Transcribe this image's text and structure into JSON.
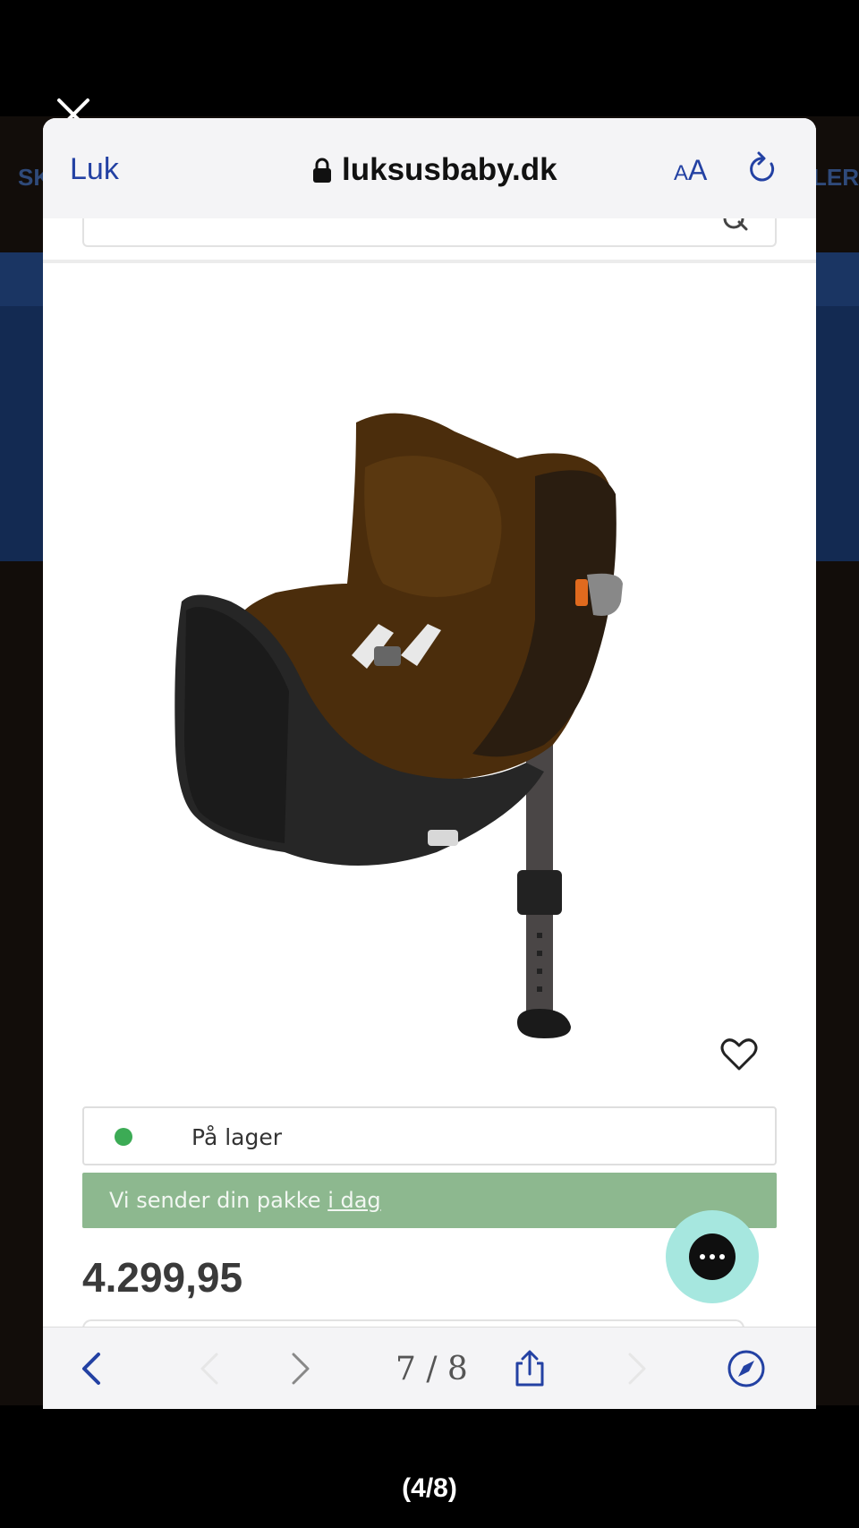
{
  "browser": {
    "close_label": "Luk",
    "url": "luksusbaby.dk",
    "text_size_small": "A",
    "text_size_large": "A"
  },
  "background_page": {
    "left_text": "SK",
    "right_text": "LER"
  },
  "product": {
    "stock_status": "På lager",
    "shipping_prefix": "Vi sender din pakke ",
    "shipping_link": "i dag",
    "price": "4.299,95"
  },
  "viewer": {
    "counter": "7 / 8"
  },
  "caption": "(4/8)",
  "colors": {
    "link_blue": "#2341a3",
    "stock_green": "#3cab55",
    "ship_bar": "#8db88f",
    "chat_bubble": "#a6e7df"
  },
  "icons": [
    "close-icon",
    "lock-icon",
    "reload-icon",
    "search-icon",
    "heart-icon",
    "chat-icon",
    "back-icon",
    "prev-icon",
    "next-icon",
    "share-icon",
    "forward-icon",
    "compass-icon"
  ]
}
